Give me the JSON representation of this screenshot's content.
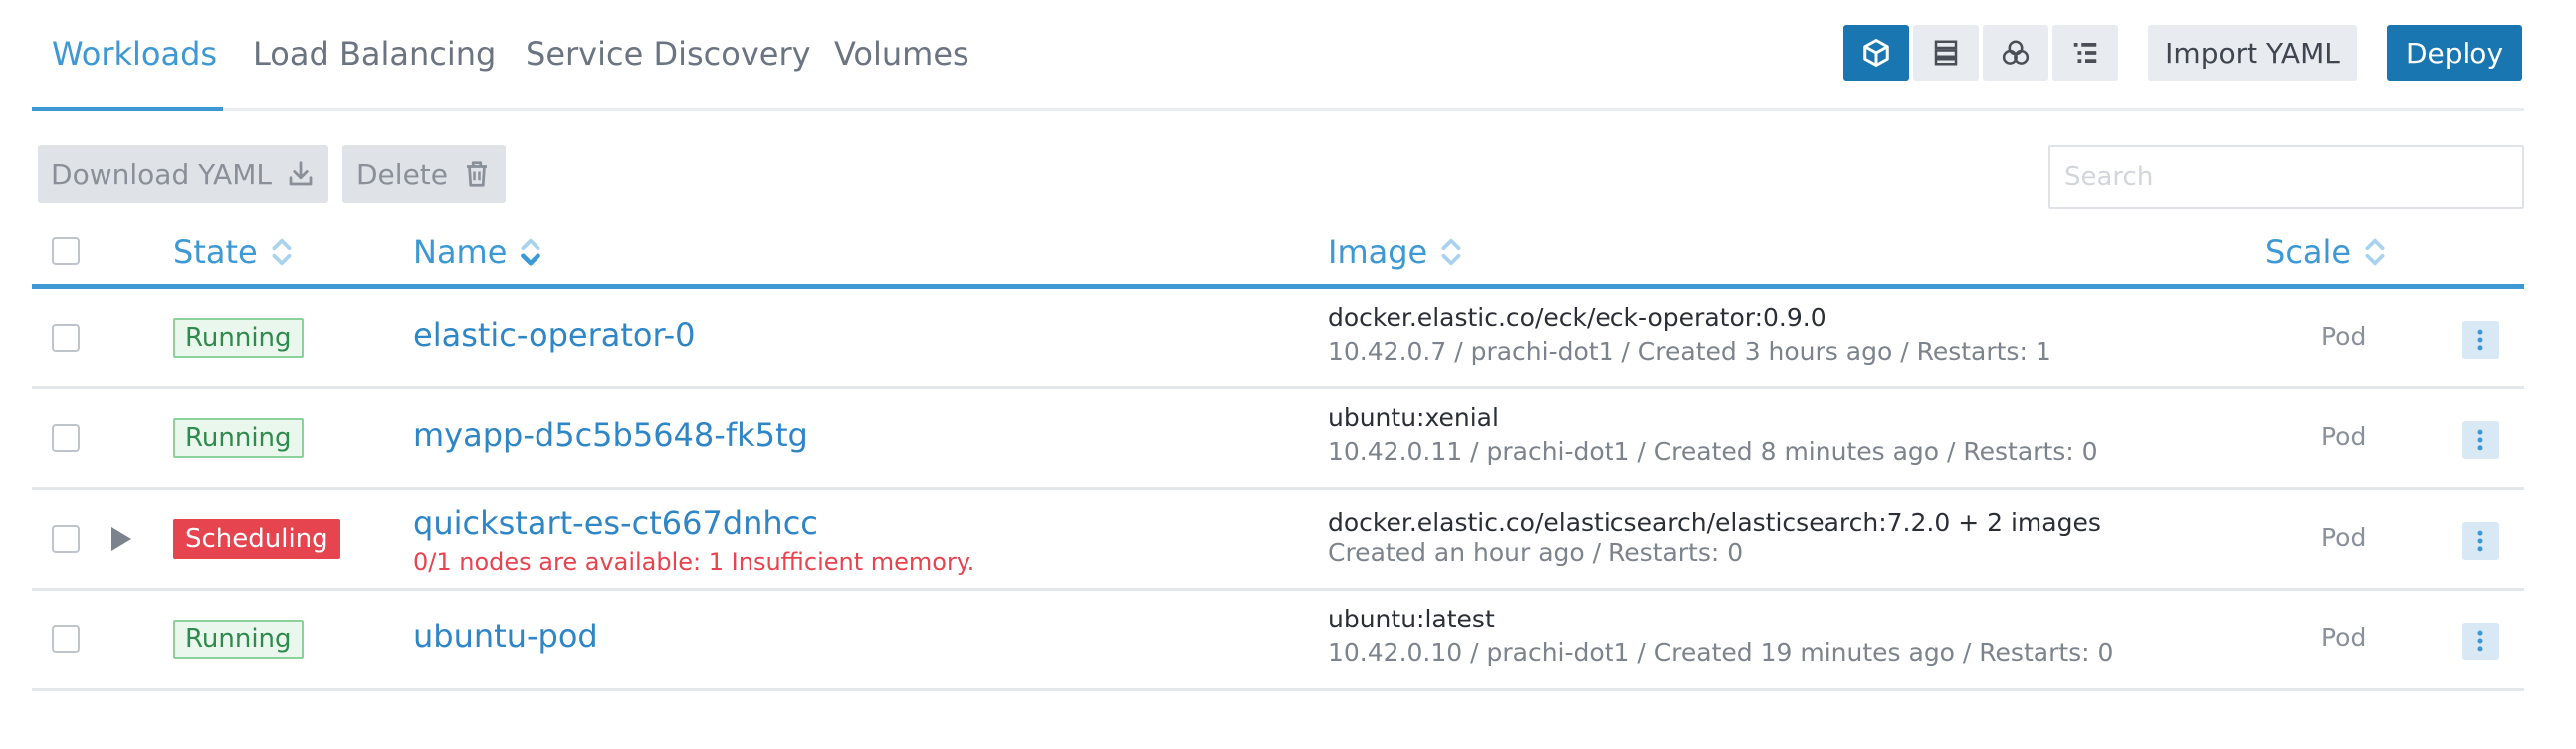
{
  "tabs": [
    {
      "label": "Workloads",
      "active": true
    },
    {
      "label": "Load Balancing",
      "active": false
    },
    {
      "label": "Service Discovery",
      "active": false
    },
    {
      "label": "Volumes",
      "active": false
    }
  ],
  "view_toggles": [
    {
      "icon": "cube-icon",
      "active": true
    },
    {
      "icon": "list-node-icon",
      "active": false
    },
    {
      "icon": "group-icon",
      "active": false
    },
    {
      "icon": "tree-list-icon",
      "active": false
    }
  ],
  "toolbar": {
    "import_label": "Import YAML",
    "deploy_label": "Deploy"
  },
  "bulk": {
    "download_label": "Download YAML",
    "delete_label": "Delete",
    "search_placeholder": "Search"
  },
  "columns": {
    "state": "State",
    "name": "Name",
    "image": "Image",
    "scale": "Scale"
  },
  "rows": [
    {
      "state": "Running",
      "state_type": "running",
      "name": "elastic-operator-0",
      "error": "",
      "image": "docker.elastic.co/eck/eck-operator:0.9.0",
      "details": "10.42.0.7 / prachi-dot1 / Created 3 hours ago / Restarts: 1",
      "scale": "Pod"
    },
    {
      "state": "Running",
      "state_type": "running",
      "name": "myapp-d5c5b5648-fk5tg",
      "error": "",
      "image": "ubuntu:xenial",
      "details": "10.42.0.11 / prachi-dot1 / Created 8 minutes ago / Restarts: 0",
      "scale": "Pod"
    },
    {
      "state": "Scheduling",
      "state_type": "scheduling",
      "name": "quickstart-es-ct667dnhcc",
      "error": "0/1 nodes are available: 1 Insufficient memory.",
      "image": "docker.elastic.co/elasticsearch/elasticsearch:7.2.0 + 2 images",
      "details": "Created an hour ago / Restarts: 0",
      "scale": "Pod"
    },
    {
      "state": "Running",
      "state_type": "running",
      "name": "ubuntu-pod",
      "error": "",
      "image": "ubuntu:latest",
      "details": "10.42.0.10 / prachi-dot1 / Created 19 minutes ago / Restarts: 0",
      "scale": "Pod"
    }
  ],
  "colors": {
    "accent": "#3d98d3",
    "primary_button": "#1a76b0",
    "running": "#2e8b4d",
    "scheduling": "#e6444e"
  }
}
